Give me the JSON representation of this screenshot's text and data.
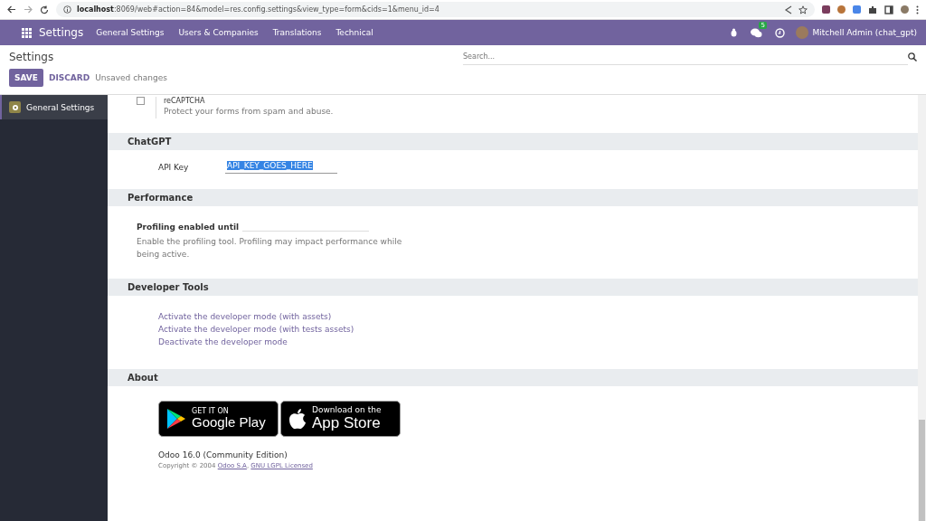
{
  "browser": {
    "url_host": "localhost",
    "url_rest": ":8069/web#action=84&model=res.config.settings&view_type=form&cids=1&menu_id=4"
  },
  "navbar": {
    "app": "Settings",
    "menu": [
      "General Settings",
      "Users & Companies",
      "Translations",
      "Technical"
    ],
    "messages_count": "5",
    "user": "Mitchell Admin (chat_gpt)"
  },
  "control_panel": {
    "title": "Settings",
    "search": {
      "placeholder": "Search..."
    },
    "save": "SAVE",
    "discard": "DISCARD",
    "status": "Unsaved changes"
  },
  "sidebar": {
    "items": [
      {
        "label": "General Settings",
        "selected": true
      }
    ]
  },
  "recaptcha": {
    "label": "reCAPTCHA",
    "checked": false,
    "description": "Protect your forms from spam and abuse."
  },
  "sections": [
    {
      "kind": "field",
      "title": "ChatGPT",
      "label": "API Key",
      "value": "API_KEY_GOES_HERE"
    },
    {
      "kind": "profiling",
      "title": "Performance",
      "label": "Profiling enabled until",
      "description": "Enable the profiling tool. Profiling may impact performance while being active."
    },
    {
      "kind": "links",
      "title": "Developer Tools",
      "links": [
        "Activate the developer mode (with assets)",
        "Activate the developer mode (with tests assets)",
        "Deactivate the developer mode"
      ]
    },
    {
      "kind": "about",
      "title": "About",
      "google_play": {
        "top": "GET IT ON",
        "bottom": "Google Play"
      },
      "app_store": {
        "top": "Download on the",
        "bottom": "App Store"
      },
      "version": "Odoo 16.0 (Community Edition)",
      "copyright": "Copyright © 2004",
      "company_link": "Odoo S.A",
      "separator": ",",
      "license_link": "GNU LGPL Licensed"
    }
  ]
}
